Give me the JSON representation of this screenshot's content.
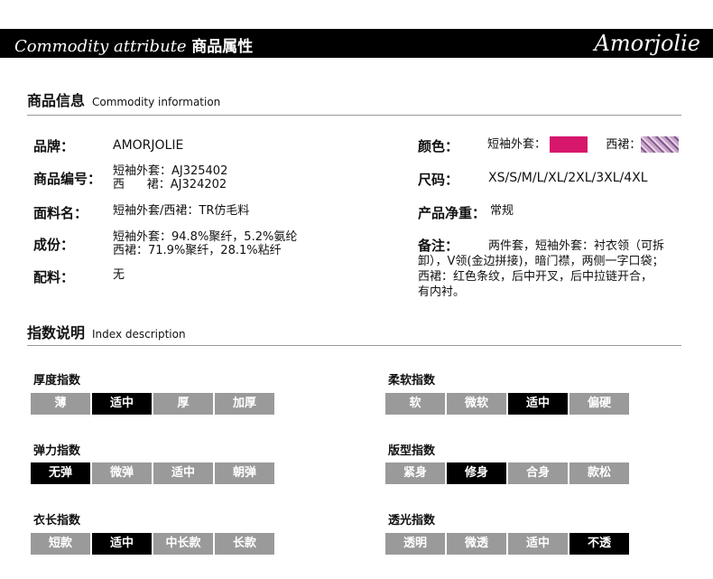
{
  "banner": {
    "title_en": "Commodity attribute",
    "title_cn": "商品属性",
    "brand": "Amorjolie"
  },
  "info": {
    "title_cn": "商品信息",
    "title_en": "Commodity information",
    "brand_label": "品牌：",
    "brand_value": "AMORJOLIE",
    "code_label": "商品编号：",
    "code_line1": "短袖外套：AJ325402",
    "code_line2": "西      裙：AJ324202",
    "fabric_label": "面料名：",
    "fabric_value": "短袖外套/西裙：TR仿毛料",
    "comp_label": "成份：",
    "comp_line1": "短袖外套：94.8%聚纤，5.2%氨纶",
    "comp_line2": "西裙：71.9%聚纤，28.1%粘纤",
    "acc_label": "配料：",
    "acc_value": "无",
    "color_label": "颜色：",
    "color_jacket": "短袖外套：",
    "color_skirt": "西裙：",
    "jacket_color": "#d6176b",
    "size_label": "尺码：",
    "size_value": "XS/S/M/L/XL/2XL/3XL/4XL",
    "weight_label": "产品净重：",
    "weight_value": "常规",
    "note_label": "备注：",
    "note_line1": "两件套，短袖外套：衬衣领（可拆",
    "note_line2": "卸），V领(金边拼接)，暗门襟，两侧一字口袋；",
    "note_line3": "西裙：红色条纹，后中开叉，后中拉链开合，",
    "note_line4": "有内衬。"
  },
  "index": {
    "title_cn": "指数说明",
    "title_en": "Index description",
    "groups": [
      {
        "title": "厚度指数",
        "options": [
          "薄",
          "适中",
          "厚",
          "加厚"
        ],
        "selected": "适中"
      },
      {
        "title": "柔软指数",
        "options": [
          "软",
          "微软",
          "适中",
          "偏硬"
        ],
        "selected": "适中"
      },
      {
        "title": "弹力指数",
        "options": [
          "无弹",
          "微弹",
          "适中",
          "朝弹"
        ],
        "selected": "无弹"
      },
      {
        "title": "版型指数",
        "options": [
          "紧身",
          "修身",
          "合身",
          "款松"
        ],
        "selected": "修身"
      },
      {
        "title": "衣长指数",
        "options": [
          "短款",
          "适中",
          "中长款",
          "长款"
        ],
        "selected": "适中"
      },
      {
        "title": "透光指数",
        "options": [
          "透明",
          "微透",
          "适中",
          "不透"
        ],
        "selected": "不透"
      }
    ]
  }
}
